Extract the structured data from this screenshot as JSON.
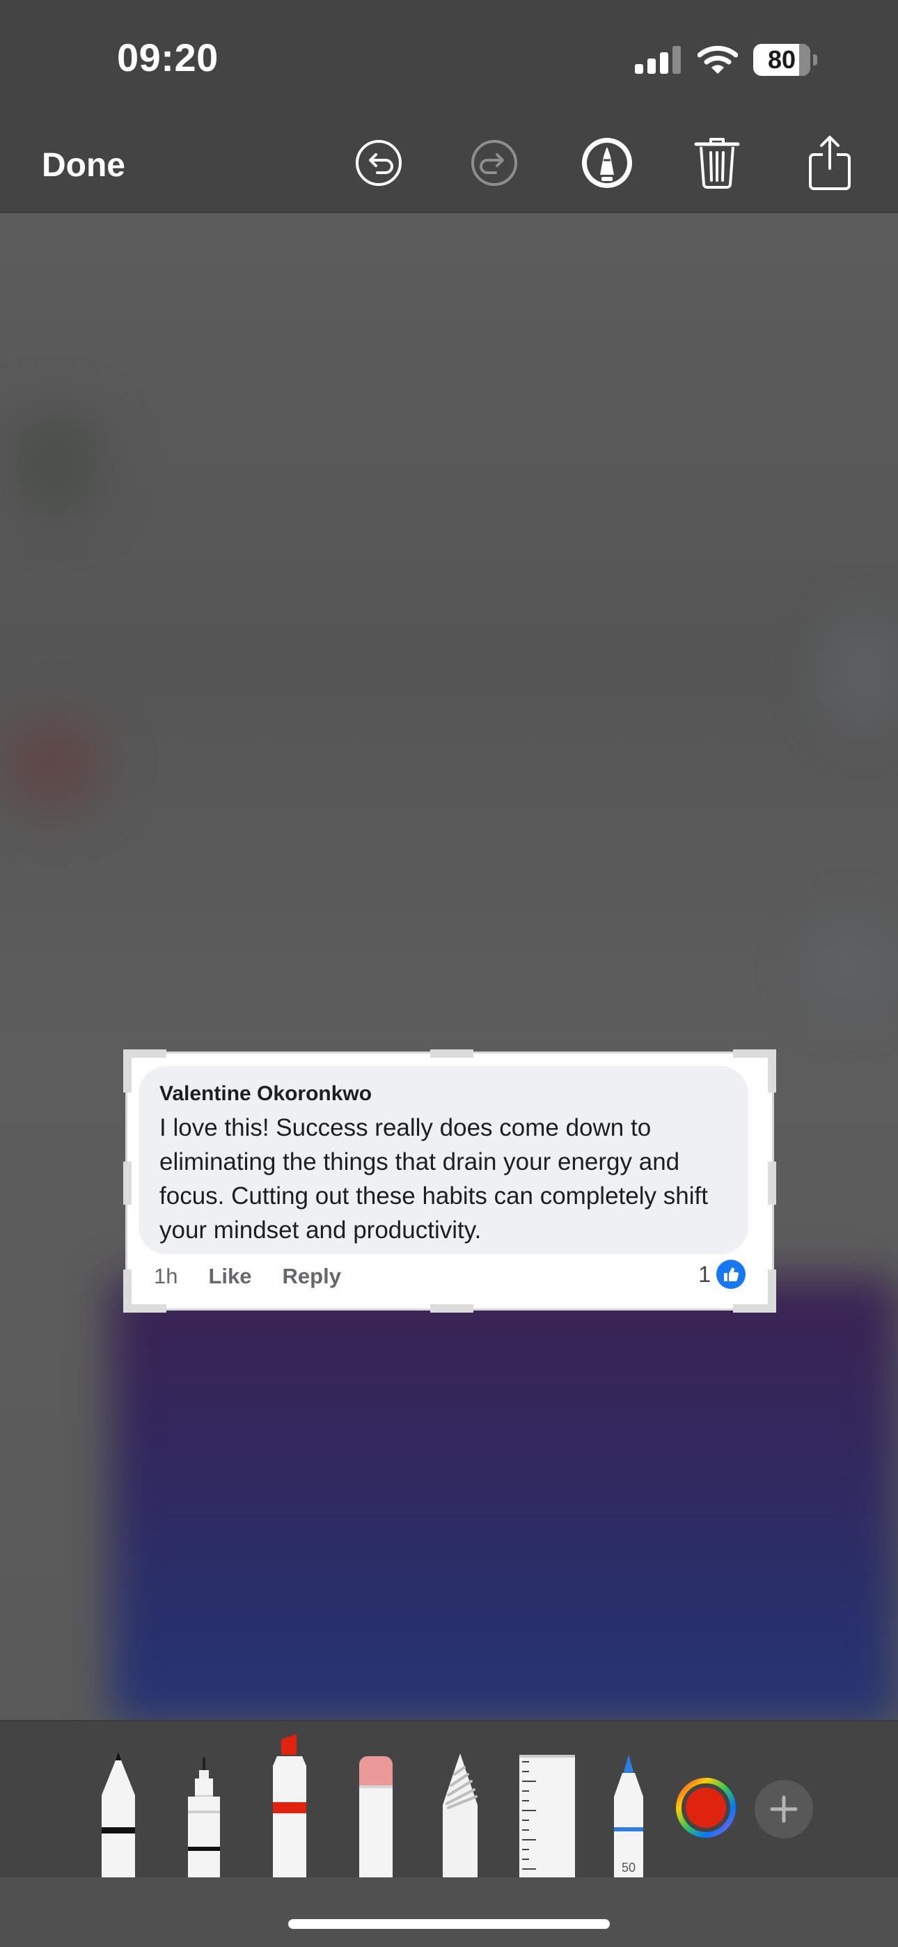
{
  "status_bar": {
    "time": "09:20",
    "battery_level": "80",
    "battery_fraction": 0.8,
    "icons": [
      "cellular-signal-icon",
      "wifi-icon",
      "battery-icon"
    ]
  },
  "toolbar": {
    "done_label": "Done",
    "icons": [
      "undo-icon",
      "redo-icon",
      "markup-pen-icon",
      "trash-icon",
      "share-icon"
    ]
  },
  "comment": {
    "author": "Valentine Okoronkwo",
    "text": "I love this! Success really does come down to eliminating the things that drain your energy and focus. Cutting out these habits can completely shift your mindset and productivity.",
    "time": "1h",
    "like_label": "Like",
    "reply_label": "Reply",
    "like_count": "1"
  },
  "tools": {
    "items": [
      "pen",
      "monoline",
      "marker",
      "eraser",
      "lasso",
      "ruler",
      "crayon"
    ],
    "crayon_width": "50",
    "current_color": "#e0230f",
    "icons": [
      "color-picker-icon",
      "add-icon"
    ]
  },
  "colors": {
    "brand_blue": "#1877f2",
    "toolbar_bg": "#444444",
    "canvas_bg": "#5e5e5e"
  }
}
